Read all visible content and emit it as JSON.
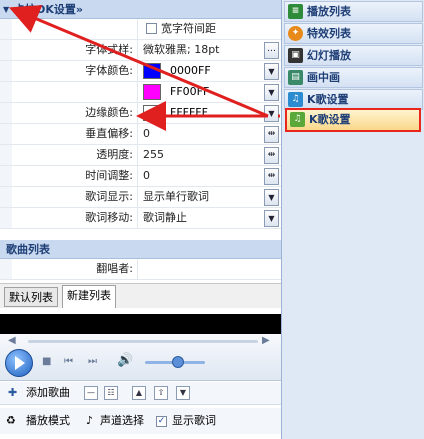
{
  "section_karaoke": {
    "title": "卡拉OK设置»"
  },
  "props": {
    "wide_spacing": "宽字符间距",
    "font_style_label": "字体式样:",
    "font_style_value": "微软雅黑; 18pt",
    "font_color_label": "字体颜色:",
    "font_color_1": "0000FF",
    "font_color_2": "FF00FF",
    "border_color_label": "边缘颜色:",
    "border_color_value": "FFFFFF",
    "vertical_offset_label": "垂直偏移:",
    "vertical_offset_value": "0",
    "opacity_label": "透明度:",
    "opacity_value": "255",
    "time_adjust_label": "时间调整:",
    "time_adjust_value": "0",
    "lyric_display_label": "歌词显示:",
    "lyric_display_value": "显示单行歌词",
    "lyric_move_label": "歌词移动:",
    "lyric_move_value": "歌词静止"
  },
  "section_songlist": {
    "title": "歌曲列表",
    "singer_label": "翻唱者:"
  },
  "tabs": [
    "默认列表",
    "新建列表"
  ],
  "toolbar": {
    "add_song": "添加歌曲",
    "play_mode": "播放模式",
    "channel_select": "声道选择",
    "show_lyrics": "显示歌词"
  },
  "nav": [
    {
      "label": "播放列表",
      "icon": "playlist-icon"
    },
    {
      "label": "特效列表",
      "icon": "effects-icon"
    },
    {
      "label": "幻灯播放",
      "icon": "slideshow-icon"
    },
    {
      "label": "画中画",
      "icon": "pip-icon"
    },
    {
      "label": "K歌设置",
      "icon": "karaoke-icon"
    },
    {
      "label": "K歌设置",
      "icon": "karaoke-icon"
    }
  ],
  "colors": {
    "blue": "#0000FF",
    "magenta": "#FF00FF",
    "white": "#FFFFFF",
    "highlight_border": "#E8261C"
  }
}
